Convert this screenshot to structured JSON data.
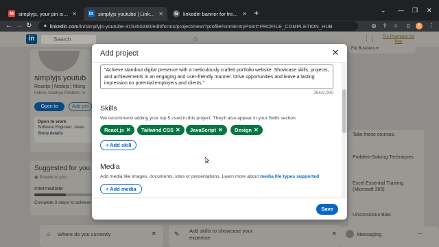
{
  "browser": {
    "tabs": [
      {
        "favicon": "M",
        "favicon_color": "#ea4335",
        "title": "simplyjs, your pin is 443415. Plea",
        "active": false
      },
      {
        "favicon": "in",
        "favicon_color": "#0a66c2",
        "title": "simplyjs youtube | LinkedIn",
        "active": true
      },
      {
        "favicon": "G",
        "favicon_color": "#5f6368",
        "title": "linkedin banner for freshers - Go",
        "active": false
      }
    ],
    "new_tab": "+",
    "url_host": "linkedin.com",
    "url_path": "/in/simplyjs-youtube-315350280/edit/forms/project/new/?profileFormEntryPoint=PROFILE_COMPLETION_HUB",
    "window_controls": [
      "⌄",
      "—",
      "❐",
      "✕"
    ]
  },
  "linkedin": {
    "logo": "in",
    "search_placeholder": "Search",
    "premium": "Try Premium for free",
    "for_business": "For Business ▾",
    "profile": {
      "name": "simplyjs youtub",
      "headline": "Reactjs | Nodejs | Mong",
      "location": "Indore, Madhya Pradesh, In",
      "open_to_btn": "Open to",
      "add_profile_btn": "Add pro",
      "open_to_work_title": "Open to work",
      "open_to_work_roles": "Software Engineer, Javas",
      "show_details": "Show details"
    },
    "suggested": {
      "title": "Suggested for you",
      "subtitle": "Private to you",
      "level": "Intermediate",
      "progress_text": "Complete 3 steps to achieve",
      "progress_fraction": 0.55
    },
    "bottom": {
      "question": "Where do you currently",
      "add_skills": "Add skills to showcase your",
      "add_skills_2": "expertise"
    },
    "right_rail": {
      "see_more": "See the courses",
      "courses_intro": "Take these courses,",
      "courses": [
        "Problem-Solving Techniques",
        "Excel Essential Training (Microsoft 365)",
        "Unconscious Bias"
      ]
    },
    "messaging": "Messaging"
  },
  "modal": {
    "title": "Add project",
    "description": "\"Achieve standout digital presence with a meticulously crafted portfolio website. Showcase skills, projects, and achievements in an engaging and user-friendly manner. Drive opportunities and leave a lasting impression on potential employers and clients.\"",
    "char_count": "254/2,000",
    "skills": {
      "title": "Skills",
      "subtitle": "We recommend adding your top 5 used in this project. They'll also appear in your Skills section.",
      "items": [
        "React.js",
        "Tailwind CSS",
        "JavaScript",
        "Design"
      ],
      "add_label": "+ Add skill"
    },
    "media": {
      "title": "Media",
      "subtitle_prefix": "Add media like images, documents, sites or presentations. Learn more about",
      "subtitle_link": "media file types supported",
      "add_label": "+ Add media"
    },
    "save_label": "Save",
    "accent_color": "#0a66c2",
    "pill_color": "#057642"
  }
}
